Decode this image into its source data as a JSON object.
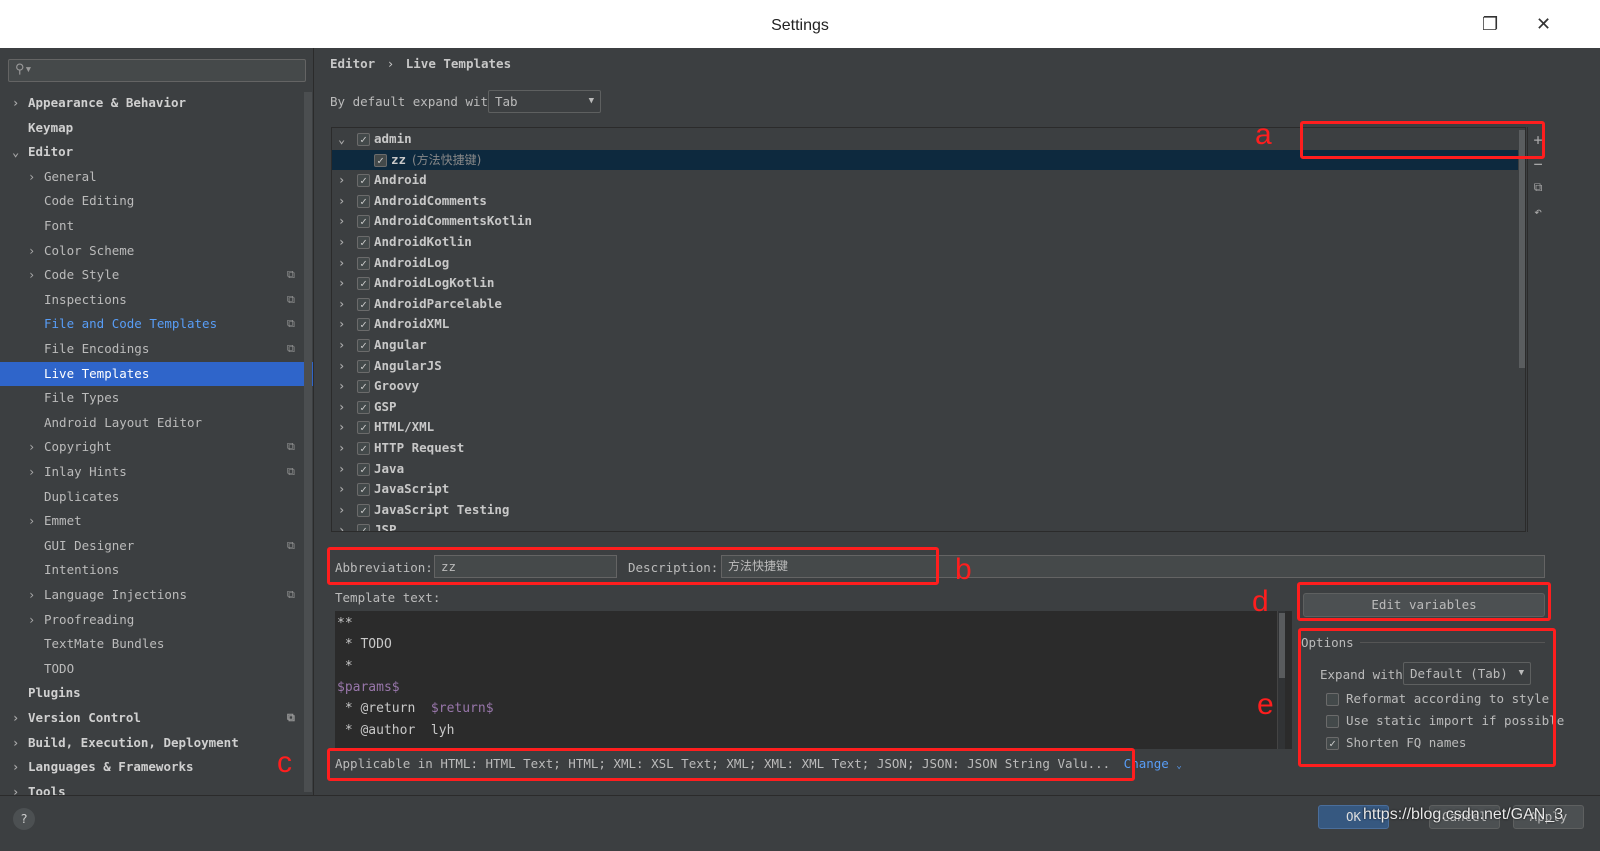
{
  "window": {
    "title": "Settings"
  },
  "sidebar": {
    "search_placeholder": "",
    "items": [
      {
        "label": "Appearance & Behavior",
        "level": 0,
        "chevron": "right",
        "bold": true
      },
      {
        "label": "Keymap",
        "level": 0,
        "bold": true
      },
      {
        "label": "Editor",
        "level": 0,
        "chevron": "down",
        "bold": true
      },
      {
        "label": "General",
        "level": 1,
        "chevron": "right"
      },
      {
        "label": "Code Editing",
        "level": 1
      },
      {
        "label": "Font",
        "level": 1
      },
      {
        "label": "Color Scheme",
        "level": 1,
        "chevron": "right"
      },
      {
        "label": "Code Style",
        "level": 1,
        "chevron": "right",
        "copy": true
      },
      {
        "label": "Inspections",
        "level": 1,
        "copy": true
      },
      {
        "label": "File and Code Templates",
        "level": 1,
        "copy": true,
        "link": true
      },
      {
        "label": "File Encodings",
        "level": 1,
        "copy": true
      },
      {
        "label": "Live Templates",
        "level": 1,
        "selected": true
      },
      {
        "label": "File Types",
        "level": 1
      },
      {
        "label": "Android Layout Editor",
        "level": 1
      },
      {
        "label": "Copyright",
        "level": 1,
        "chevron": "right",
        "copy": true
      },
      {
        "label": "Inlay Hints",
        "level": 1,
        "chevron": "right",
        "copy": true
      },
      {
        "label": "Duplicates",
        "level": 1
      },
      {
        "label": "Emmet",
        "level": 1,
        "chevron": "right"
      },
      {
        "label": "GUI Designer",
        "level": 1,
        "copy": true
      },
      {
        "label": "Intentions",
        "level": 1
      },
      {
        "label": "Language Injections",
        "level": 1,
        "chevron": "right",
        "copy": true
      },
      {
        "label": "Proofreading",
        "level": 1,
        "chevron": "right"
      },
      {
        "label": "TextMate Bundles",
        "level": 1
      },
      {
        "label": "TODO",
        "level": 1
      },
      {
        "label": "Plugins",
        "level": 0,
        "bold": true
      },
      {
        "label": "Version Control",
        "level": 0,
        "chevron": "right",
        "bold": true,
        "copy": true
      },
      {
        "label": "Build, Execution, Deployment",
        "level": 0,
        "chevron": "right",
        "bold": true
      },
      {
        "label": "Languages & Frameworks",
        "level": 0,
        "chevron": "right",
        "bold": true
      },
      {
        "label": "Tools",
        "level": 0,
        "chevron": "right",
        "bold": true
      }
    ]
  },
  "breadcrumb": {
    "parent": "Editor",
    "separator": "›",
    "current": "Live Templates"
  },
  "expand": {
    "label": "By default expand with",
    "value": "Tab"
  },
  "tree": {
    "groups": [
      {
        "label": "admin",
        "expanded": true,
        "checked": true,
        "children": [
          {
            "label": "zz",
            "description": "(方法快捷键)",
            "checked": true,
            "selected": true
          }
        ]
      },
      {
        "label": "Android",
        "checked": true
      },
      {
        "label": "AndroidComments",
        "checked": true
      },
      {
        "label": "AndroidCommentsKotlin",
        "checked": true
      },
      {
        "label": "AndroidKotlin",
        "checked": true
      },
      {
        "label": "AndroidLog",
        "checked": true
      },
      {
        "label": "AndroidLogKotlin",
        "checked": true
      },
      {
        "label": "AndroidParcelable",
        "checked": true
      },
      {
        "label": "AndroidXML",
        "checked": true
      },
      {
        "label": "Angular",
        "checked": true
      },
      {
        "label": "AngularJS",
        "checked": true
      },
      {
        "label": "Groovy",
        "checked": true
      },
      {
        "label": "GSP",
        "checked": true
      },
      {
        "label": "HTML/XML",
        "checked": true
      },
      {
        "label": "HTTP Request",
        "checked": true
      },
      {
        "label": "Java",
        "checked": true
      },
      {
        "label": "JavaScript",
        "checked": true
      },
      {
        "label": "JavaScript Testing",
        "checked": true
      },
      {
        "label": "JSP",
        "checked": true
      }
    ],
    "tools": [
      "plus-icon",
      "minus-icon",
      "copy-icon",
      "revert-icon"
    ]
  },
  "form": {
    "abbreviation_label": "Abbreviation:",
    "abbreviation_value": "zz",
    "description_label": "Description:",
    "description_value": "方法快捷键",
    "template_label": "Template text:",
    "template_lines": [
      "**",
      " * TODO",
      " *",
      "$params$",
      " * @return  $return$",
      " * @author  lyh"
    ],
    "applicable_text": "Applicable in HTML: HTML Text; HTML; XML: XSL Text; XML; XML: XML Text; JSON; JSON: JSON String Valu...",
    "change_label": "Change"
  },
  "options": {
    "edit_variables": "Edit variables",
    "title": "Options",
    "expand_label": "Expand with",
    "expand_value": "Default (Tab)",
    "checkboxes": [
      {
        "label": "Reformat according to style",
        "checked": false
      },
      {
        "label": "Use static import if possible",
        "checked": false
      },
      {
        "label": "Shorten FQ names",
        "checked": true
      }
    ]
  },
  "annotations": [
    "a",
    "b",
    "c",
    "d",
    "e"
  ],
  "footer": {
    "ok": "OK",
    "cancel": "Cancel",
    "apply": "Apply",
    "help": "?",
    "watermark": "https://blog.csdn.net/GAN_3"
  },
  "colors": {
    "selection": "#2f65ca",
    "tree_selection": "#0d293e",
    "link": "#589df6",
    "annotation": "#ff1e1e",
    "template_var": "#9876aa"
  }
}
